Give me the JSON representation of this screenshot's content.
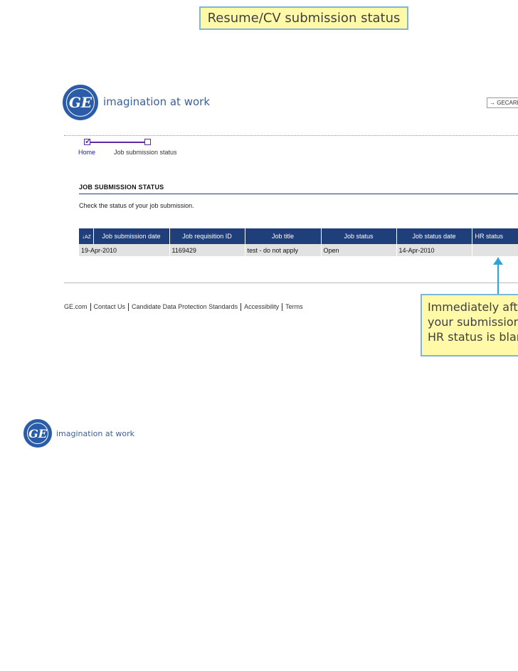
{
  "slide_title": "Resume/CV submission status",
  "brand": {
    "tagline": "imagination at work",
    "logo_text": "GE"
  },
  "top_link": "→ GECAREERS",
  "progress": {
    "steps": [
      {
        "label": "Home",
        "checked": true
      },
      {
        "label": "Job submission status",
        "checked": false
      }
    ]
  },
  "section": {
    "title": "JOB SUBMISSION STATUS",
    "description": "Check the status of your job submission."
  },
  "table": {
    "sort_icon": "sort-az-icon",
    "columns": [
      "Job submission date",
      "Job requisition ID",
      "Job title",
      "Job status",
      "Job status date",
      "HR status"
    ],
    "rows": [
      [
        "19-Apr-2010",
        "1169429",
        "test - do not apply",
        "Open",
        "14-Apr-2010",
        ""
      ]
    ]
  },
  "footer": {
    "links": [
      "GE.com",
      "Contact Us",
      "Candidate Data Protection Standards",
      "Accessibility",
      "Terms"
    ]
  },
  "note": {
    "lines": [
      "Immediately after",
      "your submission",
      "HR status is blank"
    ]
  },
  "colors": {
    "header_bg": "#1f3f7a",
    "callout_bg": "#fff9a8",
    "callout_border": "#7fb5d8",
    "arrow": "#2fa3d6",
    "step": "#5b2aa6"
  }
}
